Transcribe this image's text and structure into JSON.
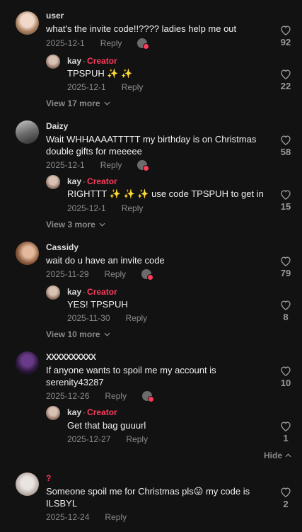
{
  "comments": [
    {
      "user": "user",
      "text": "what's the invite code!!???? ladies help me out",
      "date": "2025-12-1",
      "reply_label": "Reply",
      "likes": "92",
      "reply": {
        "user": "kay",
        "badge": "Creator",
        "text": "TPSPUH ✨ ✨",
        "date": "2025-12-1",
        "reply_label": "Reply",
        "likes": "22"
      },
      "more": "View 17 more"
    },
    {
      "user": "Daizy",
      "text": "Wait WHHAAAATTTTT my birthday is on Christmas double gifts for meeeee",
      "date": "2025-12-1",
      "reply_label": "Reply",
      "likes": "58",
      "reply": {
        "user": "kay",
        "badge": "Creator",
        "text": "RIGHTTT ✨ ✨ ✨ use code TPSPUH to get in",
        "date": "2025-12-1",
        "reply_label": "Reply",
        "likes": "15"
      },
      "more": "View 3 more"
    },
    {
      "user": "Cassidy",
      "text": "wait do u have an invite code",
      "date": "2025-11-29",
      "reply_label": "Reply",
      "likes": "79",
      "reply": {
        "user": "kay",
        "badge": "Creator",
        "text": "YES! TPSPUH",
        "date": "2025-11-30",
        "reply_label": "Reply",
        "likes": "8"
      },
      "more": "View 10 more"
    },
    {
      "user": "XXXXXXXXXX",
      "text": "If anyone wants to spoil me my account is serenity43287",
      "date": "2025-12-26",
      "reply_label": "Reply",
      "likes": "10",
      "reply": {
        "user": "kay",
        "badge": "Creator",
        "text": "Get that bag guuurl",
        "date": "2025-12-27",
        "reply_label": "Reply",
        "likes": "1"
      },
      "more": "Hide"
    },
    {
      "user": "?",
      "text": "Someone spoil me for Christmas pls😛 my code is ILSBYL",
      "date": "2025-12-24",
      "reply_label": "Reply",
      "likes": "2"
    }
  ],
  "colors": {
    "background": "#121212",
    "creator_badge": "#ff3b5c",
    "muted": "#8a8a8a"
  },
  "icons": [
    "heart-outline-icon",
    "gift-icon",
    "chevron-down-icon",
    "chevron-up-icon"
  ]
}
